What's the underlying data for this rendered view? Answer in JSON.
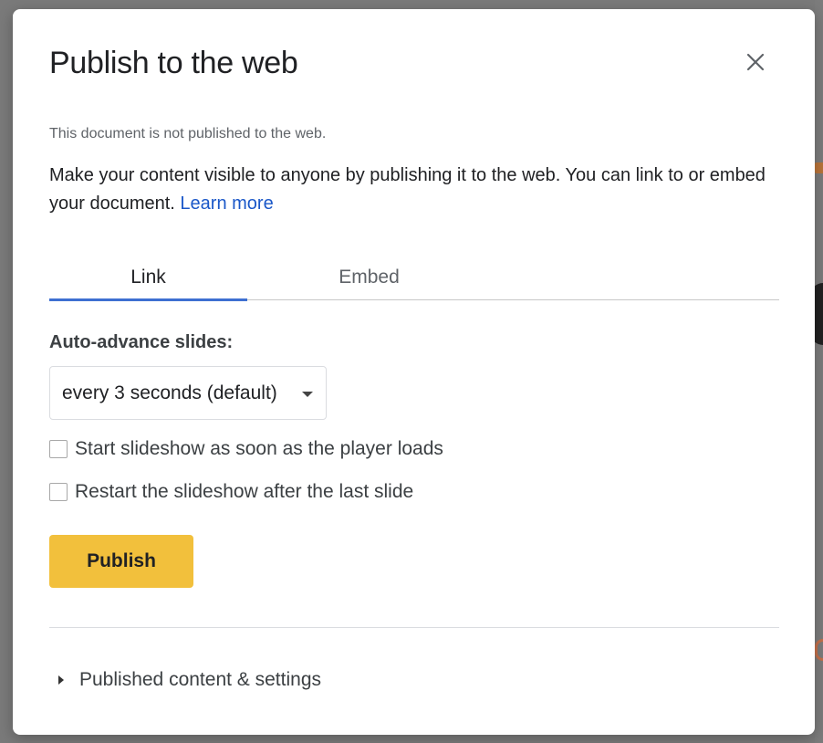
{
  "dialog": {
    "title": "Publish to the web",
    "status": "This document is not published to the web.",
    "description": "Make your content visible to anyone by publishing it to the web. You can link to or embed your document. ",
    "learn_more": "Learn more",
    "close_icon": "close-icon"
  },
  "tabs": [
    {
      "label": "Link",
      "active": true
    },
    {
      "label": "Embed",
      "active": false
    }
  ],
  "auto_advance": {
    "label": "Auto-advance slides:",
    "selected": "every 3 seconds (default)"
  },
  "options": [
    {
      "label": "Start slideshow as soon as the player loads",
      "checked": false
    },
    {
      "label": "Restart the slideshow after the last slide",
      "checked": false
    }
  ],
  "publish_label": "Publish",
  "expander_label": "Published content & settings",
  "colors": {
    "accent": "#3e6fd1",
    "publish": "#f2c03c",
    "link": "#1a57c8"
  }
}
